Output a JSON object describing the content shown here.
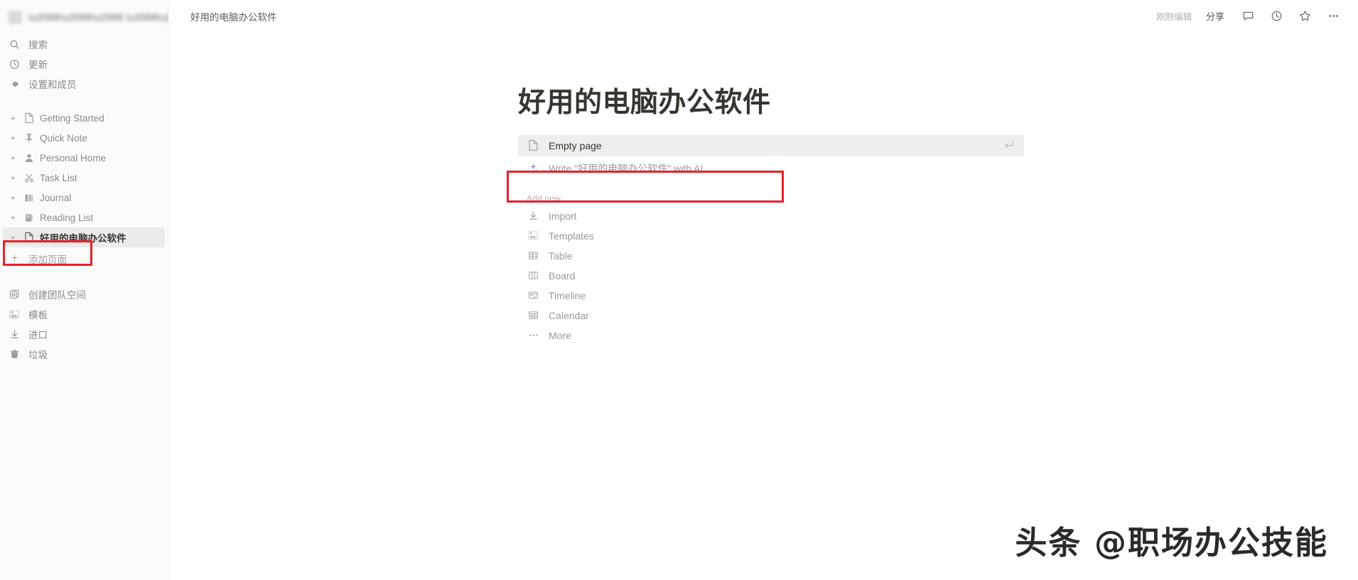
{
  "sidebar": {
    "workspace": {
      "name": "",
      "caret": "⌄"
    },
    "nav_items": [
      {
        "label": "搜索",
        "icon": "search-icon"
      },
      {
        "label": "更新",
        "icon": "clock-icon"
      },
      {
        "label": "设置和成员",
        "icon": "gear-icon"
      }
    ],
    "pages": [
      {
        "label": "Getting Started",
        "icon": "page-icon"
      },
      {
        "label": "Quick Note",
        "icon": "pin-icon"
      },
      {
        "label": "Personal Home",
        "icon": "person-icon"
      },
      {
        "label": "Task List",
        "icon": "scissors-icon"
      },
      {
        "label": "Journal",
        "icon": "books-icon"
      },
      {
        "label": "Reading List",
        "icon": "book-icon"
      },
      {
        "label": "好用的电脑办公软件",
        "icon": "page-icon",
        "selected": true
      }
    ],
    "add_page": {
      "label": "添加页面",
      "icon": "plus-icon"
    },
    "bottom_items": [
      {
        "label": "创建团队空间",
        "icon": "teamspace-icon"
      },
      {
        "label": "模板",
        "icon": "templates-icon"
      },
      {
        "label": "进口",
        "icon": "import-icon"
      },
      {
        "label": "垃圾",
        "icon": "trash-icon"
      }
    ]
  },
  "topbar": {
    "breadcrumb": "好用的电脑办公软件",
    "edited_status": "刚刚编辑",
    "share_label": "分享",
    "icons": [
      "comment-icon",
      "history-icon",
      "star-icon",
      "more-icon"
    ]
  },
  "document": {
    "title": "好用的电脑办公软件",
    "suggestions": [
      {
        "label": "Empty page",
        "icon": "page-icon",
        "highlighted": true,
        "enter_hint": "↵"
      },
      {
        "label": "Write \"好用的电脑办公软件\" with AI...",
        "icon": "sparkle-icon",
        "annotated": true
      }
    ],
    "add_new_label": "Add new",
    "add_new_items": [
      {
        "label": "Import",
        "icon": "import-icon"
      },
      {
        "label": "Templates",
        "icon": "templates-icon"
      },
      {
        "label": "Table",
        "icon": "table-icon"
      },
      {
        "label": "Board",
        "icon": "board-icon"
      },
      {
        "label": "Timeline",
        "icon": "timeline-icon"
      },
      {
        "label": "Calendar",
        "icon": "calendar-icon"
      },
      {
        "label": "More",
        "icon": "more-icon"
      }
    ]
  },
  "watermark": {
    "text": "头条 @职场办公技能"
  },
  "colors": {
    "annotation_red": "#e8202a",
    "sidebar_bg": "#fbfbfa",
    "selected_bg": "#ebebe9",
    "text_primary": "#37352f",
    "text_muted": "#9b9a97"
  }
}
